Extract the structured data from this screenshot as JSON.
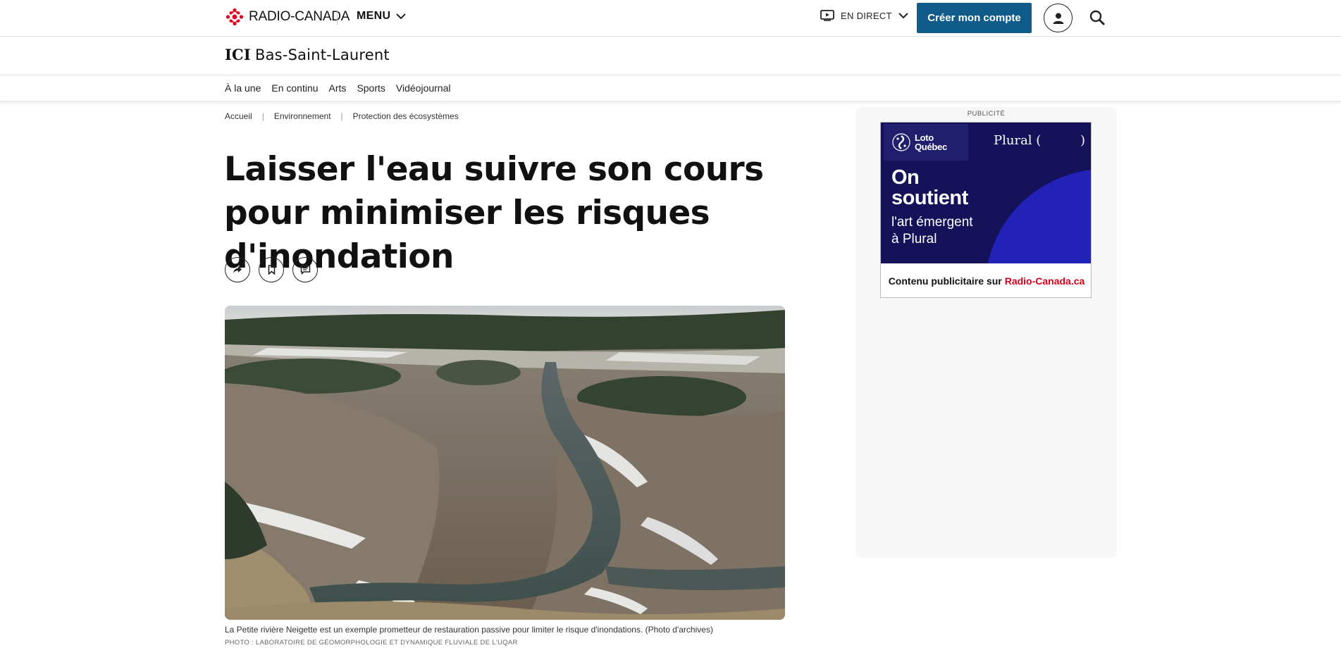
{
  "header": {
    "brand": "RADIO-CANADA",
    "menu_label": "MENU",
    "live_label": "EN DIRECT",
    "create_account_label": "Créer mon compte",
    "brand_color": "#e2001a",
    "cta_color": "#0f5c8a"
  },
  "region": {
    "prefix": "ICI",
    "name": "Bas-Saint-Laurent"
  },
  "section_nav": {
    "items": [
      {
        "label": "À la une"
      },
      {
        "label": "En continu"
      },
      {
        "label": "Arts"
      },
      {
        "label": "Sports"
      },
      {
        "label": "Vidéojournal"
      }
    ]
  },
  "breadcrumb": {
    "items": [
      {
        "label": "Accueil"
      },
      {
        "label": "Environnement"
      },
      {
        "label": "Protection des écosystèmes"
      }
    ],
    "separator": "|"
  },
  "article": {
    "headline": "Laisser l'eau suivre son cours pour minimiser les risques d'inondation",
    "caption": "La Petite rivière Neigette est un exemple prometteur de restauration passive pour limiter le risque d'inondations. (Photo d'archives)",
    "credit": "PHOTO : LABORATOIRE DE GÉOMORPHOLOGIE ET DYNAMIQUE FLUVIALE DE L'UQAR"
  },
  "actions": {
    "icons": [
      "share-icon",
      "bookmark-icon",
      "comment-icon"
    ]
  },
  "ad": {
    "label": "PUBLICITÉ",
    "loto_line1": "Loto",
    "loto_line2": "Québec",
    "plural_open": "Plural (",
    "plural_close": ")",
    "headline_line1": "On",
    "headline_line2": "soutient",
    "sub_line1": "l'art émergent",
    "sub_line2": "à Plural",
    "footer_text": "Contenu publicitaire sur",
    "footer_link": "Radio-Canada.ca"
  }
}
